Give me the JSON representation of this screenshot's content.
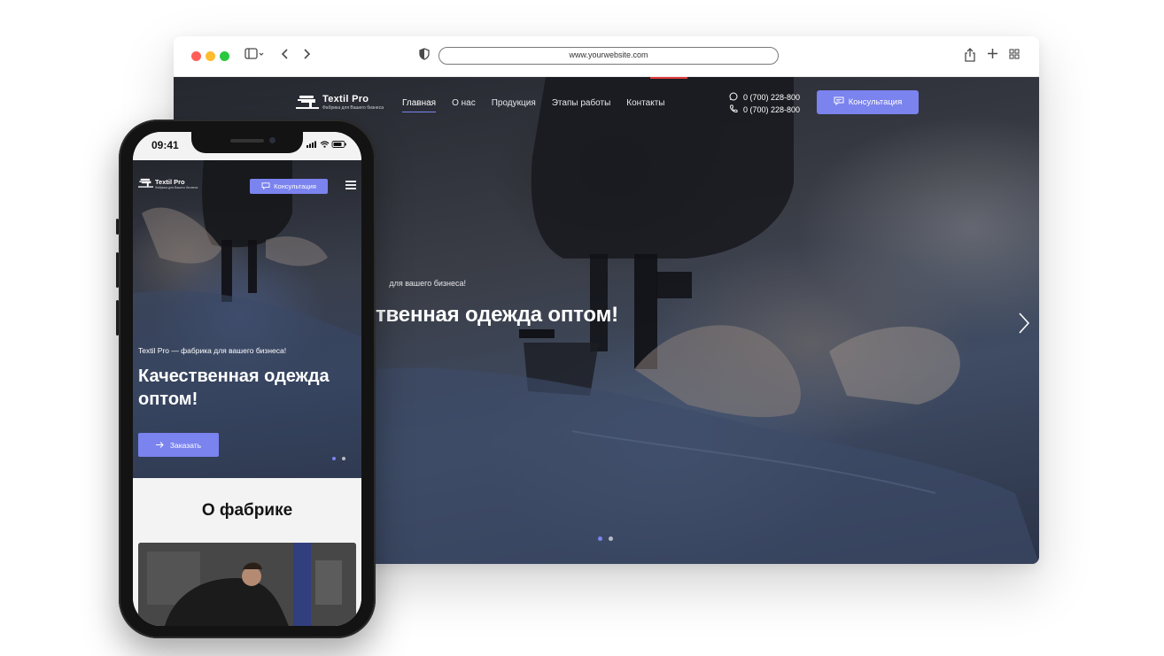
{
  "browser": {
    "url": "www.yourwebsite.com",
    "icons": {
      "sidebar": "sidebar-icon",
      "back": "chevron-left-icon",
      "forward": "chevron-right-icon",
      "shield": "shield-icon",
      "share": "share-icon",
      "new_tab": "plus-icon",
      "tabs": "grid-icon"
    }
  },
  "site": {
    "logo": {
      "name": "Textil Pro",
      "tagline": "Фабрика для Вашего бизнеса"
    },
    "nav": [
      {
        "label": "Главная",
        "active": true
      },
      {
        "label": "О нас",
        "active": false
      },
      {
        "label": "Продукция",
        "active": false
      },
      {
        "label": "Этапы работы",
        "active": false
      },
      {
        "label": "Контакты",
        "active": false
      }
    ],
    "phones": [
      "0 (700) 228-800",
      "0 (700) 228-800"
    ],
    "cta_label": "Консультация",
    "hero": {
      "subtitle_partial": "для вашего бизнеса!",
      "title_partial": "твенная одежда оптом!"
    },
    "slider": {
      "count": 2,
      "active": 1
    }
  },
  "mobile": {
    "time": "09:41",
    "logo": {
      "name": "Textil Pro",
      "tagline": "Фабрика для Вашего бизнеса"
    },
    "cta_label": "Консультация",
    "hero": {
      "subtitle": "Textil Pro — фабрика для вашего бизнеса!",
      "title": "Качественная одежда оптом!",
      "order_label": "Заказать"
    },
    "about": {
      "title": "О фабрике"
    }
  },
  "colors": {
    "accent": "#7b83ee",
    "window_red": "#ff5f57",
    "window_yellow": "#febc2e",
    "window_green": "#28c840",
    "phone_frame": "#131313"
  }
}
